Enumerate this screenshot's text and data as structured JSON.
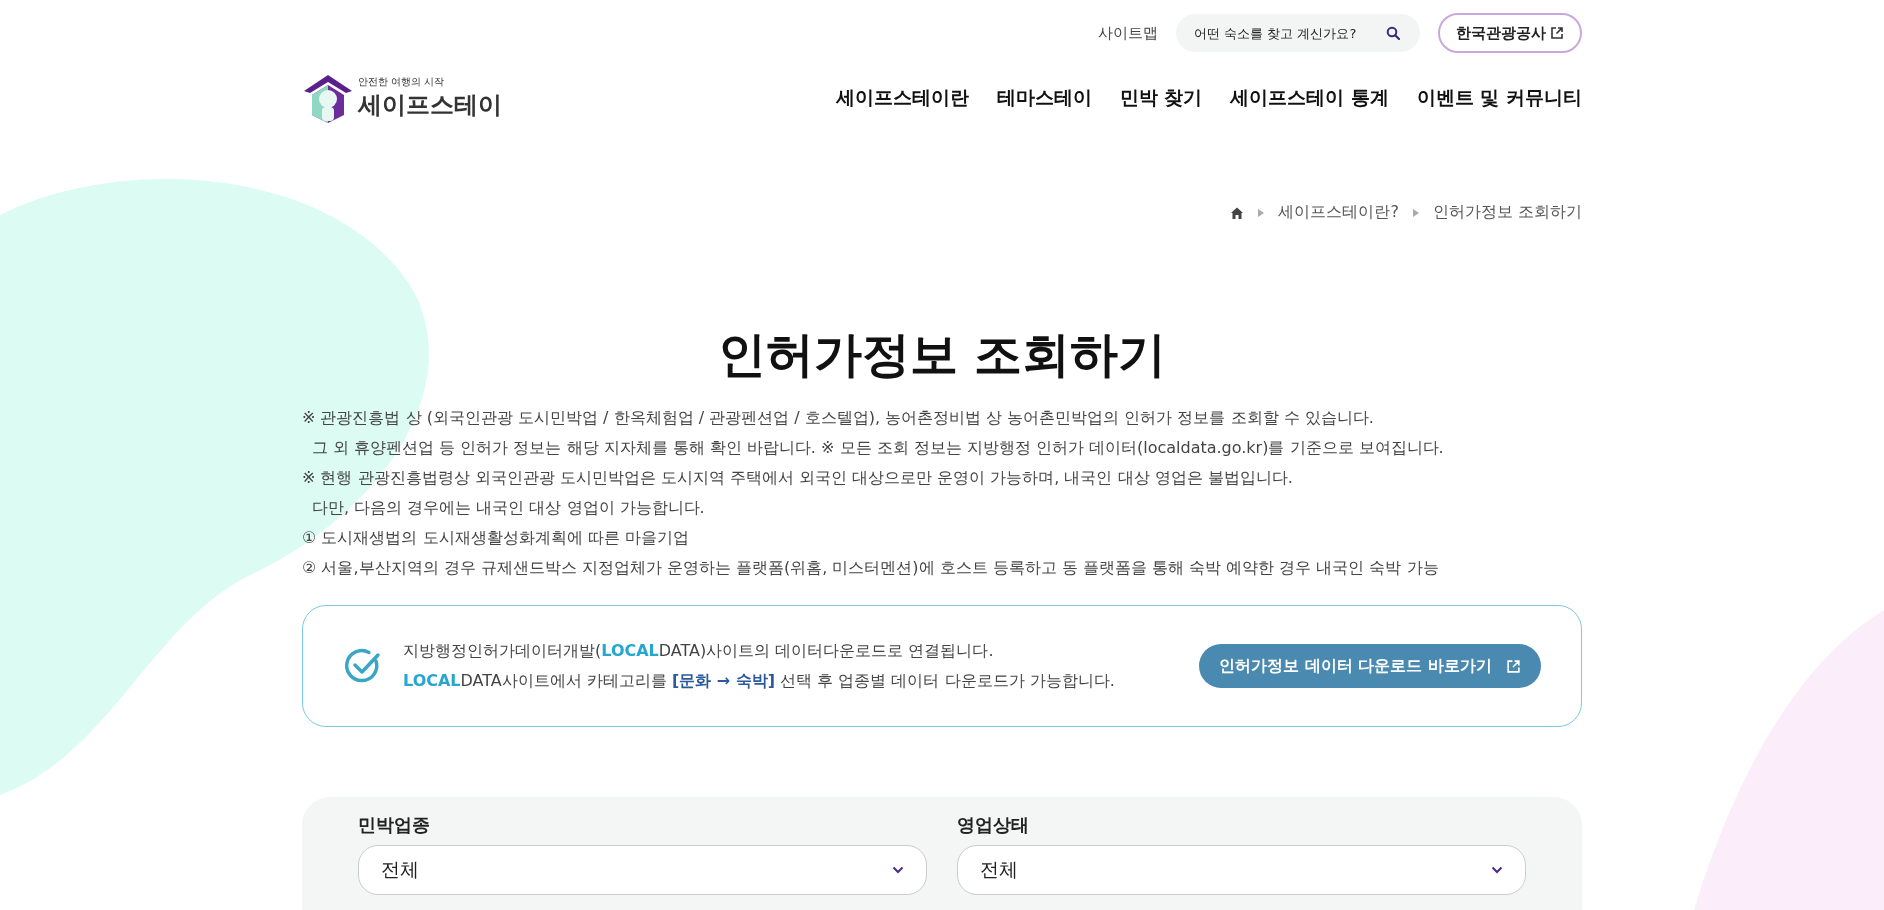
{
  "top_bar": {
    "sitemap": "사이트맵",
    "search": {
      "placeholder": "어떤 숙소를 찾고 계신가요?"
    },
    "partner_link": "한국관광공사"
  },
  "logo": {
    "tagline": "안전한 여행의 시작",
    "name": "세이프스테이"
  },
  "nav": [
    {
      "label": "세이프스테이란",
      "selected": false
    },
    {
      "label": "테마스테이",
      "selected": false
    },
    {
      "label": "민박 찾기",
      "selected": false
    },
    {
      "label": "세이프스테이 통계",
      "selected": false
    },
    {
      "label": "이벤트 및 커뮤니티",
      "selected": false
    }
  ],
  "breadcrumb": [
    "세이프스테이란?",
    "인허가정보 조회하기"
  ],
  "title": "인허가정보 조회하기",
  "notes": [
    {
      "text": "※ 관광진흥법 상 (외국인관광 도시민박업 / 한옥체험업 / 관광펜션업 / 호스텔업), 농어촌정비법 상 농어촌민박업의 인허가 정보를 조회할 수 있습니다.",
      "indent": false
    },
    {
      "text": "그 외 휴양펜션업 등 인허가 정보는 해당 지자체를 통해 확인 바랍니다. ※ 모든 조회 정보는 지방행정 인허가 데이터(localdata.go.kr)를 기준으로 보여집니다.",
      "indent": true
    },
    {
      "text": "※ 현행 관광진흥법령상 외국인관광 도시민박업은 도시지역 주택에서 외국인 대상으로만 운영이 가능하며, 내국인 대상 영업은 불법입니다.",
      "indent": false
    },
    {
      "text": "다만, 다음의 경우에는 내국인 대상 영업이 가능합니다.",
      "indent": true
    },
    {
      "text": "① 도시재생법의 도시재생활성화계획에 따른 마을기업",
      "indent": false
    },
    {
      "text": "② 서울,부산지역의 경우 규제샌드박스 지정업체가 운영하는 플랫폼(위홈, 미스터멘션)에 호스트 등록하고 동 플랫폼을 통해 숙박 예약한 경우 내국인 숙박 가능",
      "indent": false
    }
  ],
  "info_box": {
    "lines": [
      "지방행정인허가데이터개발(**LOCAL**DATA)사이트의 데이터다운로드로 연결됩니다.",
      "**LOCAL**DATA사이트에서 카테고리를 *[문화 → 숙박]* 선택 후 업종별 데이터 다운로드가 가능합니다."
    ],
    "button": "인허가정보 데이터 다운로드 바로가기"
  },
  "filters": [
    {
      "label": "민박업종",
      "value": "전체"
    },
    {
      "label": "영업상태",
      "value": "전체"
    }
  ]
}
